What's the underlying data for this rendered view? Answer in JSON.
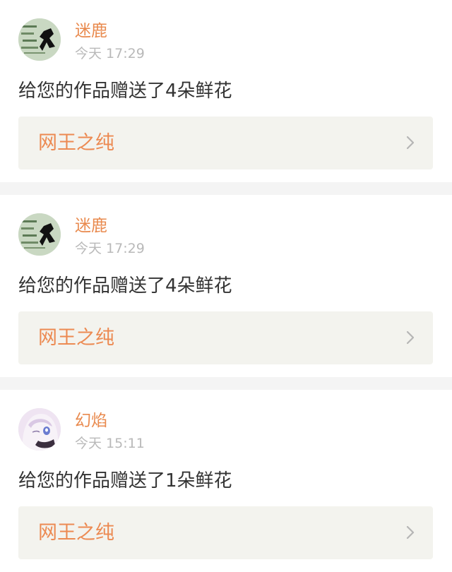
{
  "notifications": [
    {
      "username": "迷鹿",
      "time": "今天 17:29",
      "message": "给您的作品赠送了4朵鲜花",
      "work_title": "网王之纯",
      "avatar_icon": "green-stamp-avatar-icon"
    },
    {
      "username": "迷鹿",
      "time": "今天 17:29",
      "message": "给您的作品赠送了4朵鲜花",
      "work_title": "网王之纯",
      "avatar_icon": "green-stamp-avatar-icon"
    },
    {
      "username": "幻焰",
      "time": "今天 15:11",
      "message": "给您的作品赠送了1朵鲜花",
      "work_title": "网王之纯",
      "avatar_icon": "anime-girl-avatar-icon"
    }
  ],
  "colors": {
    "username": "#e98a4e",
    "work_title": "#ec8a52",
    "timestamp": "#b9b9b9",
    "message": "#333333",
    "link_background": "#f3f3ee",
    "separator": "#f4f4f4"
  }
}
